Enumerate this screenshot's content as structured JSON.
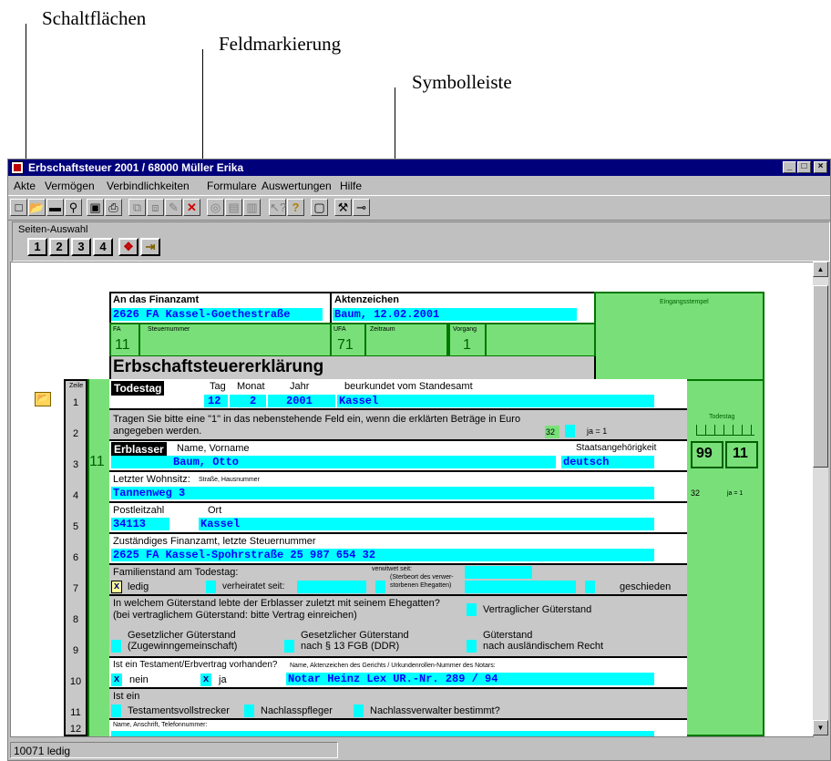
{
  "callouts": {
    "buttons": "Schaltflächen",
    "field_marking": "Feldmarkierung",
    "toolbar": "Symbolleiste"
  },
  "window": {
    "title": "Erbschaftsteuer 2001 / 68000 Müller Erika",
    "min": "_",
    "max": "□",
    "close": "×"
  },
  "menu": [
    "Akte",
    "Vermögen",
    "Verbindlichkeiten",
    "Formulare",
    "Auswertungen",
    "Hilfe"
  ],
  "page_selection": {
    "label": "Seiten-Auswahl",
    "pages": [
      "1",
      "2",
      "3",
      "4"
    ]
  },
  "status": "10071 ledig",
  "form": {
    "an_das_finanzamt": "An das Finanzamt",
    "finanzamt_value": "2626 FA Kassel-Goethestraße",
    "aktenzeichen_label": "Aktenzeichen",
    "aktenzeichen_value": "Baum, 12.02.2001",
    "eingangsstempel": "Eingangsstempel",
    "fa_label": "FA",
    "fa_value": "11",
    "steuernummer_label": "Steuernummer",
    "ufa_label": "UFA",
    "ufa_value": "71",
    "zeitraum_label": "Zeitraum",
    "vorgang_label": "Vorgang",
    "vorgang_value": "1",
    "title": "Erbschaftsteuererklärung",
    "zeile": "Zeile",
    "row_numbers": [
      "1",
      "2",
      "3",
      "4",
      "5",
      "6",
      "7",
      "8",
      "9",
      "10",
      "11",
      "12"
    ],
    "todestag": "Todestag",
    "tag": "Tag",
    "monat": "Monat",
    "jahr": "Jahr",
    "tag_value": "12",
    "monat_value": "2",
    "jahr_value": "2001",
    "standesamt_label": "beurkundet vom Standesamt",
    "standesamt_value": "Kassel",
    "todestag_side": "Todestag",
    "row2_text1": "Tragen Sie bitte eine \"1\" in das nebenstehende Feld ein, wenn die erklärten Beträge in Euro",
    "row2_text2": "angegeben werden.",
    "kz32": "32",
    "ja1": "ja = 1",
    "kz11": "11",
    "erblasser": "Erblasser",
    "name_vorname": "Name, Vorname",
    "name_value": "Baum, Otto",
    "staat_label": "Staatsangehörigkeit",
    "staat_value": "deutsch",
    "kz99": "99",
    "kz11b": "11",
    "wohnsitz_label": "Letzter Wohnsitz:",
    "wohnsitz_small": "Straße, Hausnummer",
    "wohnsitz_value": "Tannenweg 3",
    "side_kz32": "32",
    "side_ja1": "ja = 1",
    "plz_label": "Postleitzahl",
    "ort_label": "Ort",
    "plz_value": "34113",
    "ort_value": "Kassel",
    "zust_label": "Zuständiges Finanzamt, letzte Steuernummer",
    "zust_value": "2625 FA Kassel-Spohrstraße 25 987 654 32",
    "familienstand": "Familienstand am Todestag:",
    "ledig": "ledig",
    "ledig_mark": "x",
    "verheiratet": "verheiratet seit:",
    "verwitwet": "verwitwet seit:",
    "verwitwet_small1": "(Sterbeort des verwer-",
    "verwitwet_small2": "storbenen Ehegatten)",
    "geschieden": "geschieden",
    "row8_text1": "In welchem Güterstand lebte der Erblasser zuletzt mit seinem Ehegatten?",
    "row8_text2": "(bei vertraglichem Güterstand: bitte Vertrag einreichen)",
    "vertraglich": "Vertraglicher Güterstand",
    "gesetzlich1": "Gesetzlicher Güterstand",
    "gesetzlich1b": "(Zugewinngemeinschaft)",
    "gesetzlich2": "Gesetzlicher Güterstand",
    "gesetzlich2b": "nach § 13 FGB (DDR)",
    "guterstand3": "Güterstand",
    "guterstand3b": "nach ausländischem Recht",
    "testament_q": "Ist ein Testament/Erbvertrag vorhanden?",
    "notar_label": "Name, Aktenzeichen des Gerichts / Urkundenrollen-Nummer des Notars:",
    "nein": "nein",
    "ja": "ja",
    "nein_mark": "x",
    "ja_mark": "x",
    "notar_value": "Notar Heinz Lex UR.-Nr. 289 / 94",
    "ist_ein": "Ist ein",
    "tv": "Testamentsvollstrecker",
    "np": "Nachlasspfleger",
    "nv": "Nachlassverwalter",
    "bestimmt": "bestimmt?",
    "anschrift": "Name, Anschrift, Telefonnummer:"
  }
}
